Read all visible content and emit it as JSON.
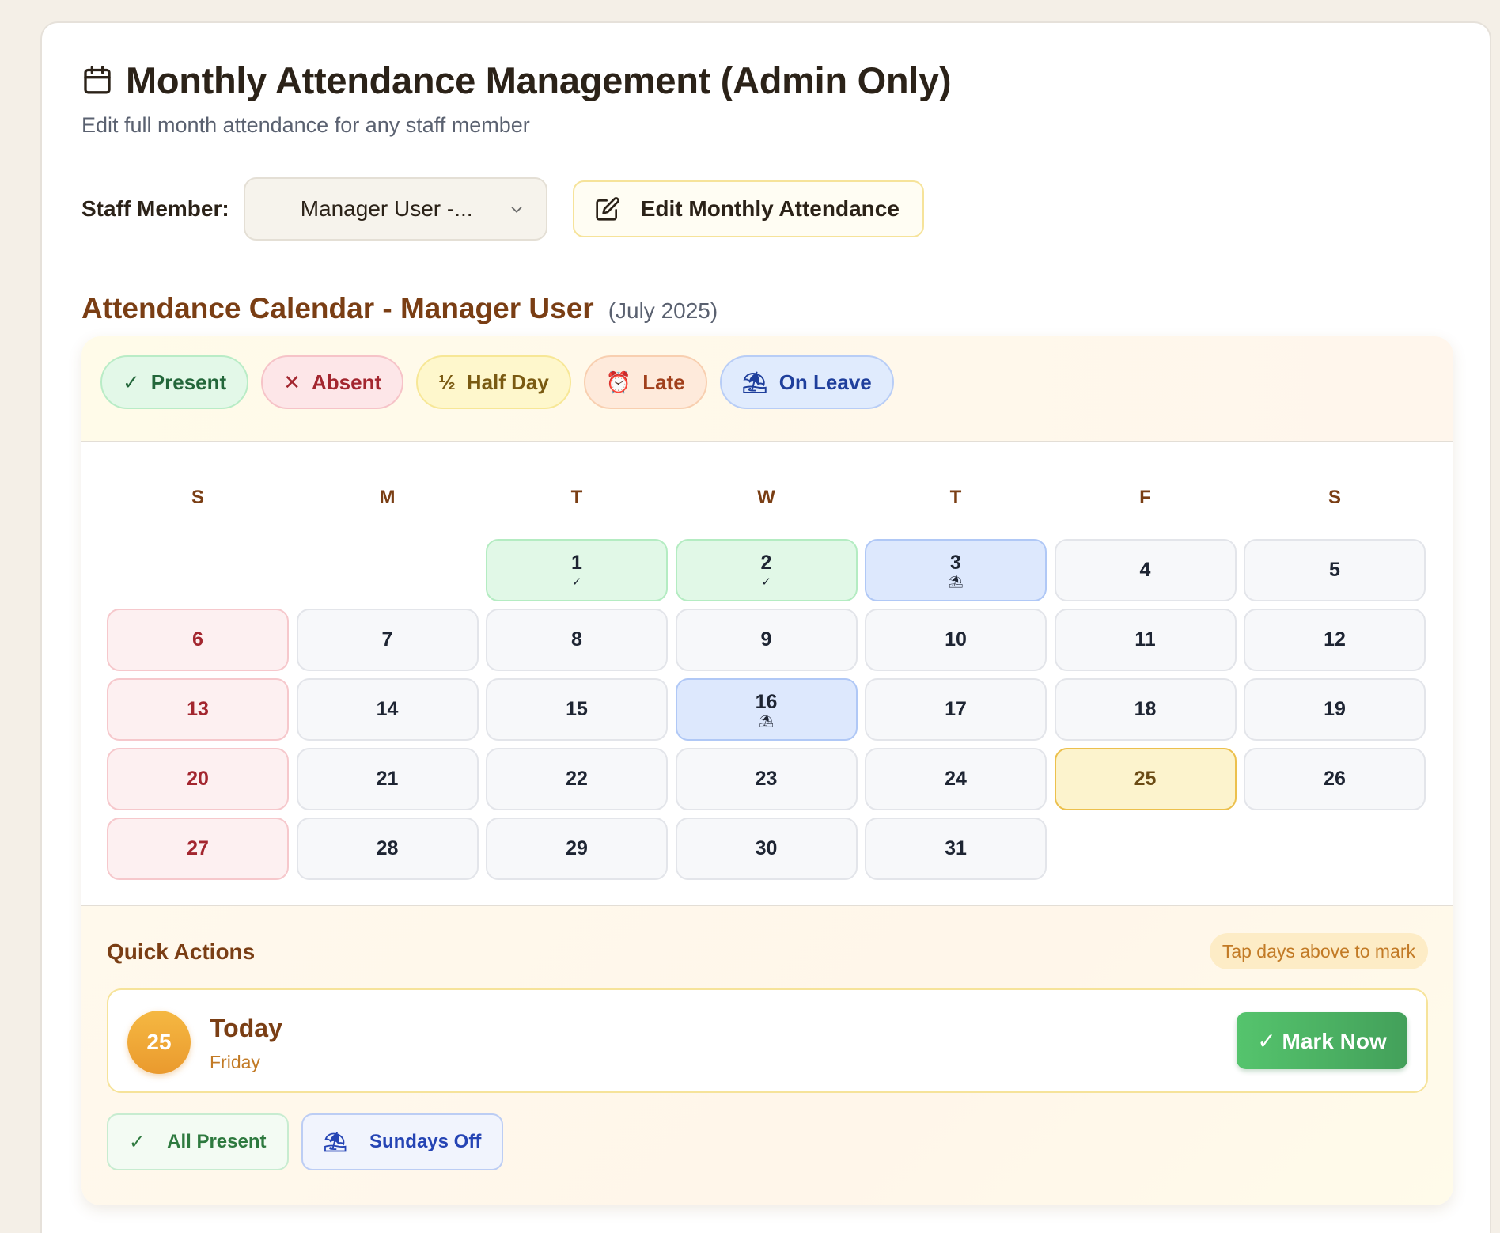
{
  "header": {
    "title": "Monthly Attendance Management (Admin Only)",
    "subtitle": "Edit full month attendance for any staff member"
  },
  "staff": {
    "label": "Staff Member:",
    "selected": "Manager User -...",
    "edit_button": "Edit Monthly Attendance"
  },
  "calendar": {
    "title": "Attendance Calendar - Manager User",
    "period": "(July 2025)",
    "weekdays": [
      "S",
      "M",
      "T",
      "W",
      "T",
      "F",
      "S"
    ],
    "days": [
      {
        "n": "",
        "mark": ""
      },
      {
        "n": "",
        "mark": ""
      },
      {
        "n": "1",
        "mark": "✓"
      },
      {
        "n": "2",
        "mark": "✓"
      },
      {
        "n": "3",
        "mark": "⛱"
      },
      {
        "n": "4",
        "mark": ""
      },
      {
        "n": "5",
        "mark": ""
      },
      {
        "n": "6",
        "mark": ""
      },
      {
        "n": "7",
        "mark": ""
      },
      {
        "n": "8",
        "mark": ""
      },
      {
        "n": "9",
        "mark": ""
      },
      {
        "n": "10",
        "mark": ""
      },
      {
        "n": "11",
        "mark": ""
      },
      {
        "n": "12",
        "mark": ""
      },
      {
        "n": "13",
        "mark": ""
      },
      {
        "n": "14",
        "mark": ""
      },
      {
        "n": "15",
        "mark": ""
      },
      {
        "n": "16",
        "mark": "⛱"
      },
      {
        "n": "17",
        "mark": ""
      },
      {
        "n": "18",
        "mark": ""
      },
      {
        "n": "19",
        "mark": ""
      },
      {
        "n": "20",
        "mark": ""
      },
      {
        "n": "21",
        "mark": ""
      },
      {
        "n": "22",
        "mark": ""
      },
      {
        "n": "23",
        "mark": ""
      },
      {
        "n": "24",
        "mark": ""
      },
      {
        "n": "25",
        "mark": ""
      },
      {
        "n": "26",
        "mark": ""
      },
      {
        "n": "27",
        "mark": ""
      },
      {
        "n": "28",
        "mark": ""
      },
      {
        "n": "29",
        "mark": ""
      },
      {
        "n": "30",
        "mark": ""
      },
      {
        "n": "31",
        "mark": ""
      }
    ]
  },
  "legend": [
    {
      "label": "Present",
      "icon": "✓"
    },
    {
      "label": "Absent",
      "icon": "✕"
    },
    {
      "label": "Half Day",
      "icon": "½"
    },
    {
      "label": "Late",
      "icon": "⏰"
    },
    {
      "label": "On Leave",
      "icon": "⛱"
    }
  ],
  "quick_actions": {
    "title": "Quick Actions",
    "hint": "Tap days above to mark",
    "today_number": "25",
    "today_label": "Today",
    "today_weekday": "Friday",
    "mark_now": "✓ Mark Now",
    "all_present_icon": "✓",
    "all_present": "All Present",
    "sundays_off_icon": "⛱",
    "sundays_off": "Sundays Off"
  },
  "colors": {
    "accent_brown": "#7a3e14",
    "present": "#e1f8e7",
    "absent": "#fde6e8",
    "leave": "#dde8fd",
    "today": "#fcf3cd",
    "mark_now": "#4bb462"
  }
}
